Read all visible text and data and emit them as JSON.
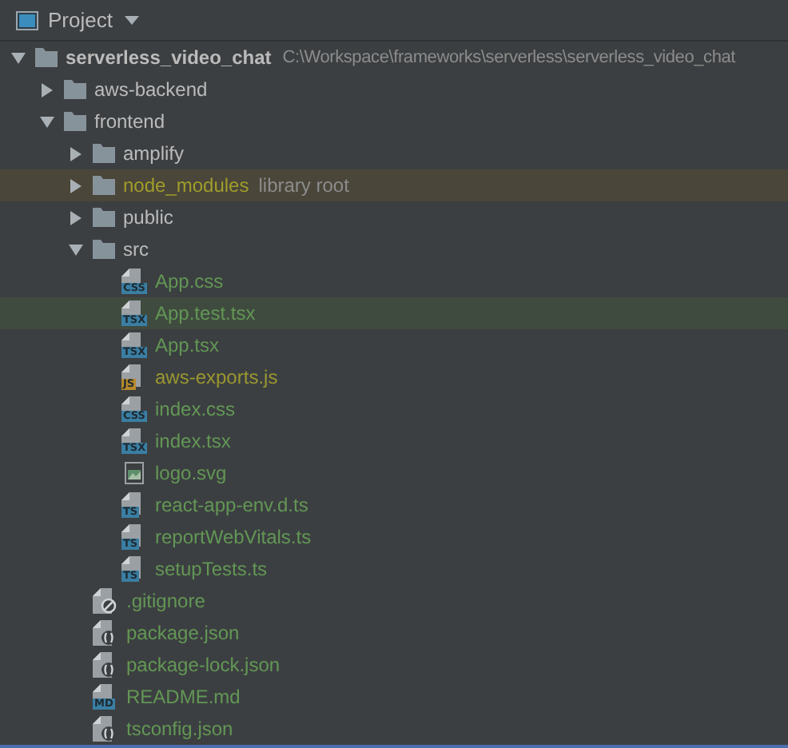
{
  "panel": {
    "title": "Project"
  },
  "tree": [
    {
      "kind": "folder",
      "name": "serverless_video_chat",
      "path": "C:\\Workspace\\frameworks\\serverless\\serverless_video_chat",
      "expanded": true,
      "selected": false,
      "color": "#bbbbbb",
      "children": [
        {
          "kind": "folder",
          "name": "aws-backend",
          "expanded": false,
          "selected": false,
          "color": "#bbbbbb"
        },
        {
          "kind": "folder",
          "name": "frontend",
          "expanded": true,
          "selected": false,
          "color": "#bbbbbb",
          "children": [
            {
              "kind": "folder",
              "name": "amplify",
              "expanded": false,
              "selected": false,
              "color": "#bbbbbb"
            },
            {
              "kind": "folder",
              "name": "node_modules",
              "note": "library root",
              "excluded": true,
              "expanded": false,
              "selected": false,
              "color": "#9f9d2b"
            },
            {
              "kind": "folder",
              "name": "public",
              "expanded": false,
              "selected": false,
              "color": "#bbbbbb"
            },
            {
              "kind": "folder",
              "name": "src",
              "expanded": true,
              "selected": false,
              "color": "#bbbbbb",
              "children": [
                {
                  "kind": "badge",
                  "badge": {
                    "text": "CSS",
                    "color": "#3a7ea3"
                  },
                  "name": "App.css",
                  "selected": false,
                  "color": "#629755"
                },
                {
                  "kind": "badge",
                  "badge": {
                    "text": "TSX",
                    "color": "#3a7ea3"
                  },
                  "name": "App.test.tsx",
                  "selected": true,
                  "color": "#629755"
                },
                {
                  "kind": "badge",
                  "badge": {
                    "text": "TSX",
                    "color": "#3a7ea3"
                  },
                  "name": "App.tsx",
                  "selected": false,
                  "color": "#629755"
                },
                {
                  "kind": "badge",
                  "badge": {
                    "text": "JS",
                    "color": "#b8892c"
                  },
                  "name": "aws-exports.js",
                  "selected": false,
                  "color": "#9a9730"
                },
                {
                  "kind": "badge",
                  "badge": {
                    "text": "CSS",
                    "color": "#3a7ea3"
                  },
                  "name": "index.css",
                  "selected": false,
                  "color": "#629755"
                },
                {
                  "kind": "badge",
                  "badge": {
                    "text": "TSX",
                    "color": "#3a7ea3"
                  },
                  "name": "index.tsx",
                  "selected": false,
                  "color": "#629755"
                },
                {
                  "kind": "image",
                  "name": "logo.svg",
                  "selected": false,
                  "color": "#629755"
                },
                {
                  "kind": "badge",
                  "badge": {
                    "text": "TS",
                    "color": "#3a7ea3"
                  },
                  "name": "react-app-env.d.ts",
                  "selected": false,
                  "color": "#629755"
                },
                {
                  "kind": "badge",
                  "badge": {
                    "text": "TS",
                    "color": "#3a7ea3"
                  },
                  "name": "reportWebVitals.ts",
                  "selected": false,
                  "color": "#629755"
                },
                {
                  "kind": "badge",
                  "badge": {
                    "text": "TS",
                    "color": "#3a7ea3"
                  },
                  "name": "setupTests.ts",
                  "selected": false,
                  "color": "#629755"
                }
              ]
            },
            {
              "kind": "ignore",
              "name": ".gitignore",
              "selected": false,
              "color": "#629755"
            },
            {
              "kind": "json",
              "name": "package.json",
              "selected": false,
              "color": "#629755"
            },
            {
              "kind": "json",
              "name": "package-lock.json",
              "selected": false,
              "color": "#629755"
            },
            {
              "kind": "badge",
              "badge": {
                "text": "MD",
                "color": "#3a7ea3"
              },
              "name": "README.md",
              "selected": false,
              "color": "#629755"
            },
            {
              "kind": "json",
              "name": "tsconfig.json",
              "selected": false,
              "color": "#629755"
            }
          ]
        }
      ]
    }
  ]
}
